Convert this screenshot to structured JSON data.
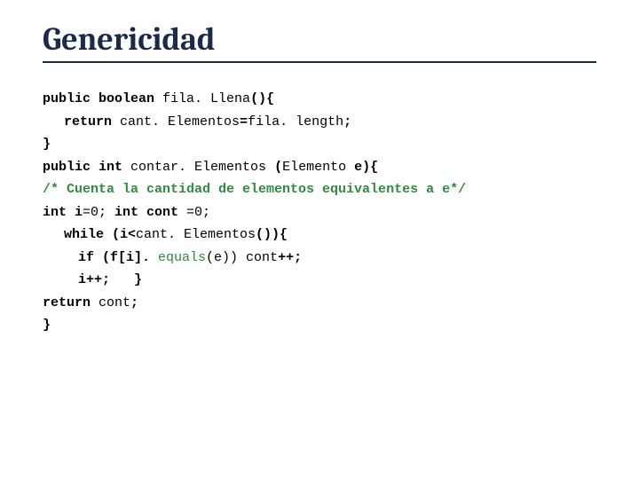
{
  "title": "Genericidad",
  "code": {
    "l1a": "public boolean ",
    "l1b": "fila. Llena",
    "l1c": "(){",
    "l2a": "return ",
    "l2b": "cant. Elementos",
    "l2c": "=",
    "l2d": "fila. length",
    "l2e": ";",
    "l3": "}",
    "l4a": "public int ",
    "l4b": "contar. Elementos",
    "l4c": " (",
    "l4d": "Elemento",
    "l4e": " e){",
    "l5": "/* Cuenta la cantidad de elementos equivalentes a e*/",
    "l6a": "int i",
    "l6b": "=0; ",
    "l6c": "int cont ",
    "l6d": "=0;",
    "l7a": "while (i<",
    "l7b": "cant. Elementos",
    "l7c": "()){",
    "l8a": "if (f[i]. ",
    "l8b": "equals",
    "l8c": "(e)) ",
    "l8d": "cont",
    "l8e": "++;",
    "l9a": "i++;",
    "l9b": "   }",
    "l10a": "return ",
    "l10b": "cont",
    "l10c": ";",
    "l11": "}"
  }
}
